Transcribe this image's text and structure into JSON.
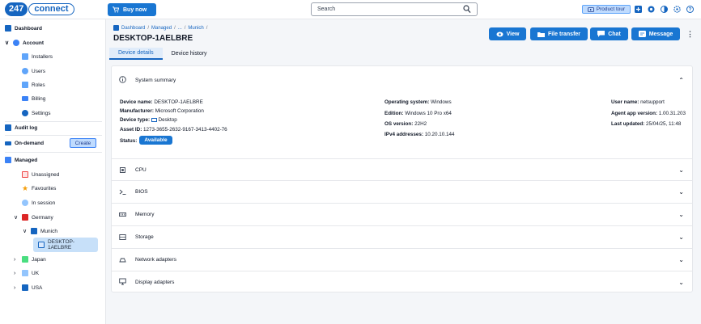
{
  "app": {
    "logo_number": "247",
    "logo_word": "connect"
  },
  "topbar": {
    "buy_label": "Buy now",
    "search_placeholder": "Search",
    "product_tour_label": "Product tour"
  },
  "sidebar": {
    "dashboard": "Dashboard",
    "account": "Account",
    "installers": "Installers",
    "users": "Users",
    "roles": "Roles",
    "billing": "Billing",
    "settings": "Settings",
    "audit_log": "Audit log",
    "on_demand": "On-demand",
    "create": "Create",
    "managed": "Managed",
    "unassigned": "Unassigned",
    "favourites": "Favourites",
    "in_session": "In session",
    "germany": "Germany",
    "munich": "Munich",
    "selected_device": "DESKTOP-1AELBRE",
    "japan": "Japan",
    "uk": "UK",
    "usa": "USA"
  },
  "breadcrumb": {
    "dashboard": "Dashboard",
    "managed": "Managed",
    "ellipsis": "...",
    "munich": "Munich",
    "sep": "/"
  },
  "device": {
    "title": "DESKTOP-1AELBRE"
  },
  "actions": {
    "view": "View",
    "file_transfer": "File transfer",
    "chat": "Chat",
    "message": "Message"
  },
  "tabs": {
    "details": "Device details",
    "history": "Device history"
  },
  "summary": {
    "heading": "System summary",
    "device_name_label": "Device name:",
    "device_name": "DESKTOP-1AELBRE",
    "manufacturer_label": "Manufacturer:",
    "manufacturer": "Microsoft Corporation",
    "device_type_label": "Device type:",
    "device_type": "Desktop",
    "asset_id_label": "Asset ID:",
    "asset_id": "1273-3655-2632-9167-3413-4402-76",
    "status_label": "Status:",
    "status": "Available",
    "os_label": "Operating system:",
    "os": "Windows",
    "edition_label": "Edition:",
    "edition": "Windows 10 Pro x64",
    "os_version_label": "OS version:",
    "os_version": "22H2",
    "ipv4_label": "IPv4 addresses:",
    "ipv4": "10.20.10.144",
    "user_label": "User name:",
    "user": "netsupport",
    "agent_label": "Agent app version:",
    "agent": "1.00.31.203",
    "updated_label": "Last updated:",
    "updated": "25/04/25, 11:48"
  },
  "sections": {
    "cpu": "CPU",
    "bios": "BIOS",
    "memory": "Memory",
    "storage": "Storage",
    "network": "Network adapters",
    "display": "Display adapters"
  },
  "colors": {
    "primary": "#1976d2",
    "brand": "#1565c0"
  }
}
